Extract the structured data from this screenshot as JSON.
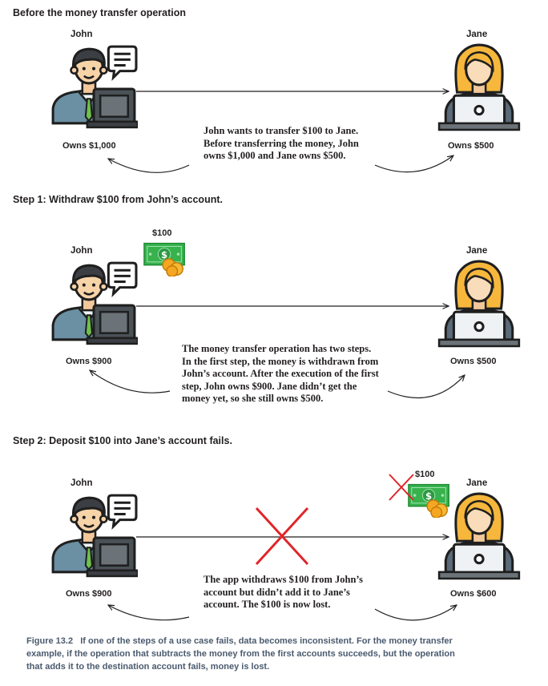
{
  "sections": [
    {
      "title": "Before the money transfer operation",
      "left_name": "John",
      "right_name": "Jane",
      "left_owns": "Owns $1,000",
      "right_owns": "Owns $500",
      "note": [
        "John wants to transfer $100 to Jane.",
        "Before transferring the money, John",
        "owns $1,000 and Jane owns $500."
      ]
    },
    {
      "title": "Step 1: Withdraw $100 from John’s account.",
      "left_name": "John",
      "right_name": "Jane",
      "left_owns": "Owns $900",
      "right_owns": "Owns $500",
      "money_label": "$100",
      "note": [
        "The money transfer operation has two steps.",
        "In the first step, the money is withdrawn from",
        "John’s account. After the execution of the first",
        "step, John owns $900. Jane didn’t get the",
        "money yet, so she still owns $500."
      ]
    },
    {
      "title": "Step 2: Deposit $100 into Jane’s account fails.",
      "left_name": "John",
      "right_name": "Jane",
      "left_owns": "Owns $900",
      "right_owns": "Owns $600",
      "money_label": "$100",
      "note": [
        "The app withdraws $100 from John’s",
        "account but didn’t add it to Jane’s",
        "account. The $100 is now lost."
      ]
    }
  ],
  "caption": {
    "label": "Figure 13.2",
    "lines": [
      "If one of the steps of a use case fails, data becomes inconsistent. For the money transfer",
      "example, if the operation that subtracts the money from the first accounts succeeds, but the operation",
      "that adds it to the destination account fails, money is lost."
    ]
  },
  "colors": {
    "accent_red": "#e0252b",
    "bill_green": "#37b24d",
    "coin": "#f5a623",
    "caption": "#4a5a6e"
  }
}
